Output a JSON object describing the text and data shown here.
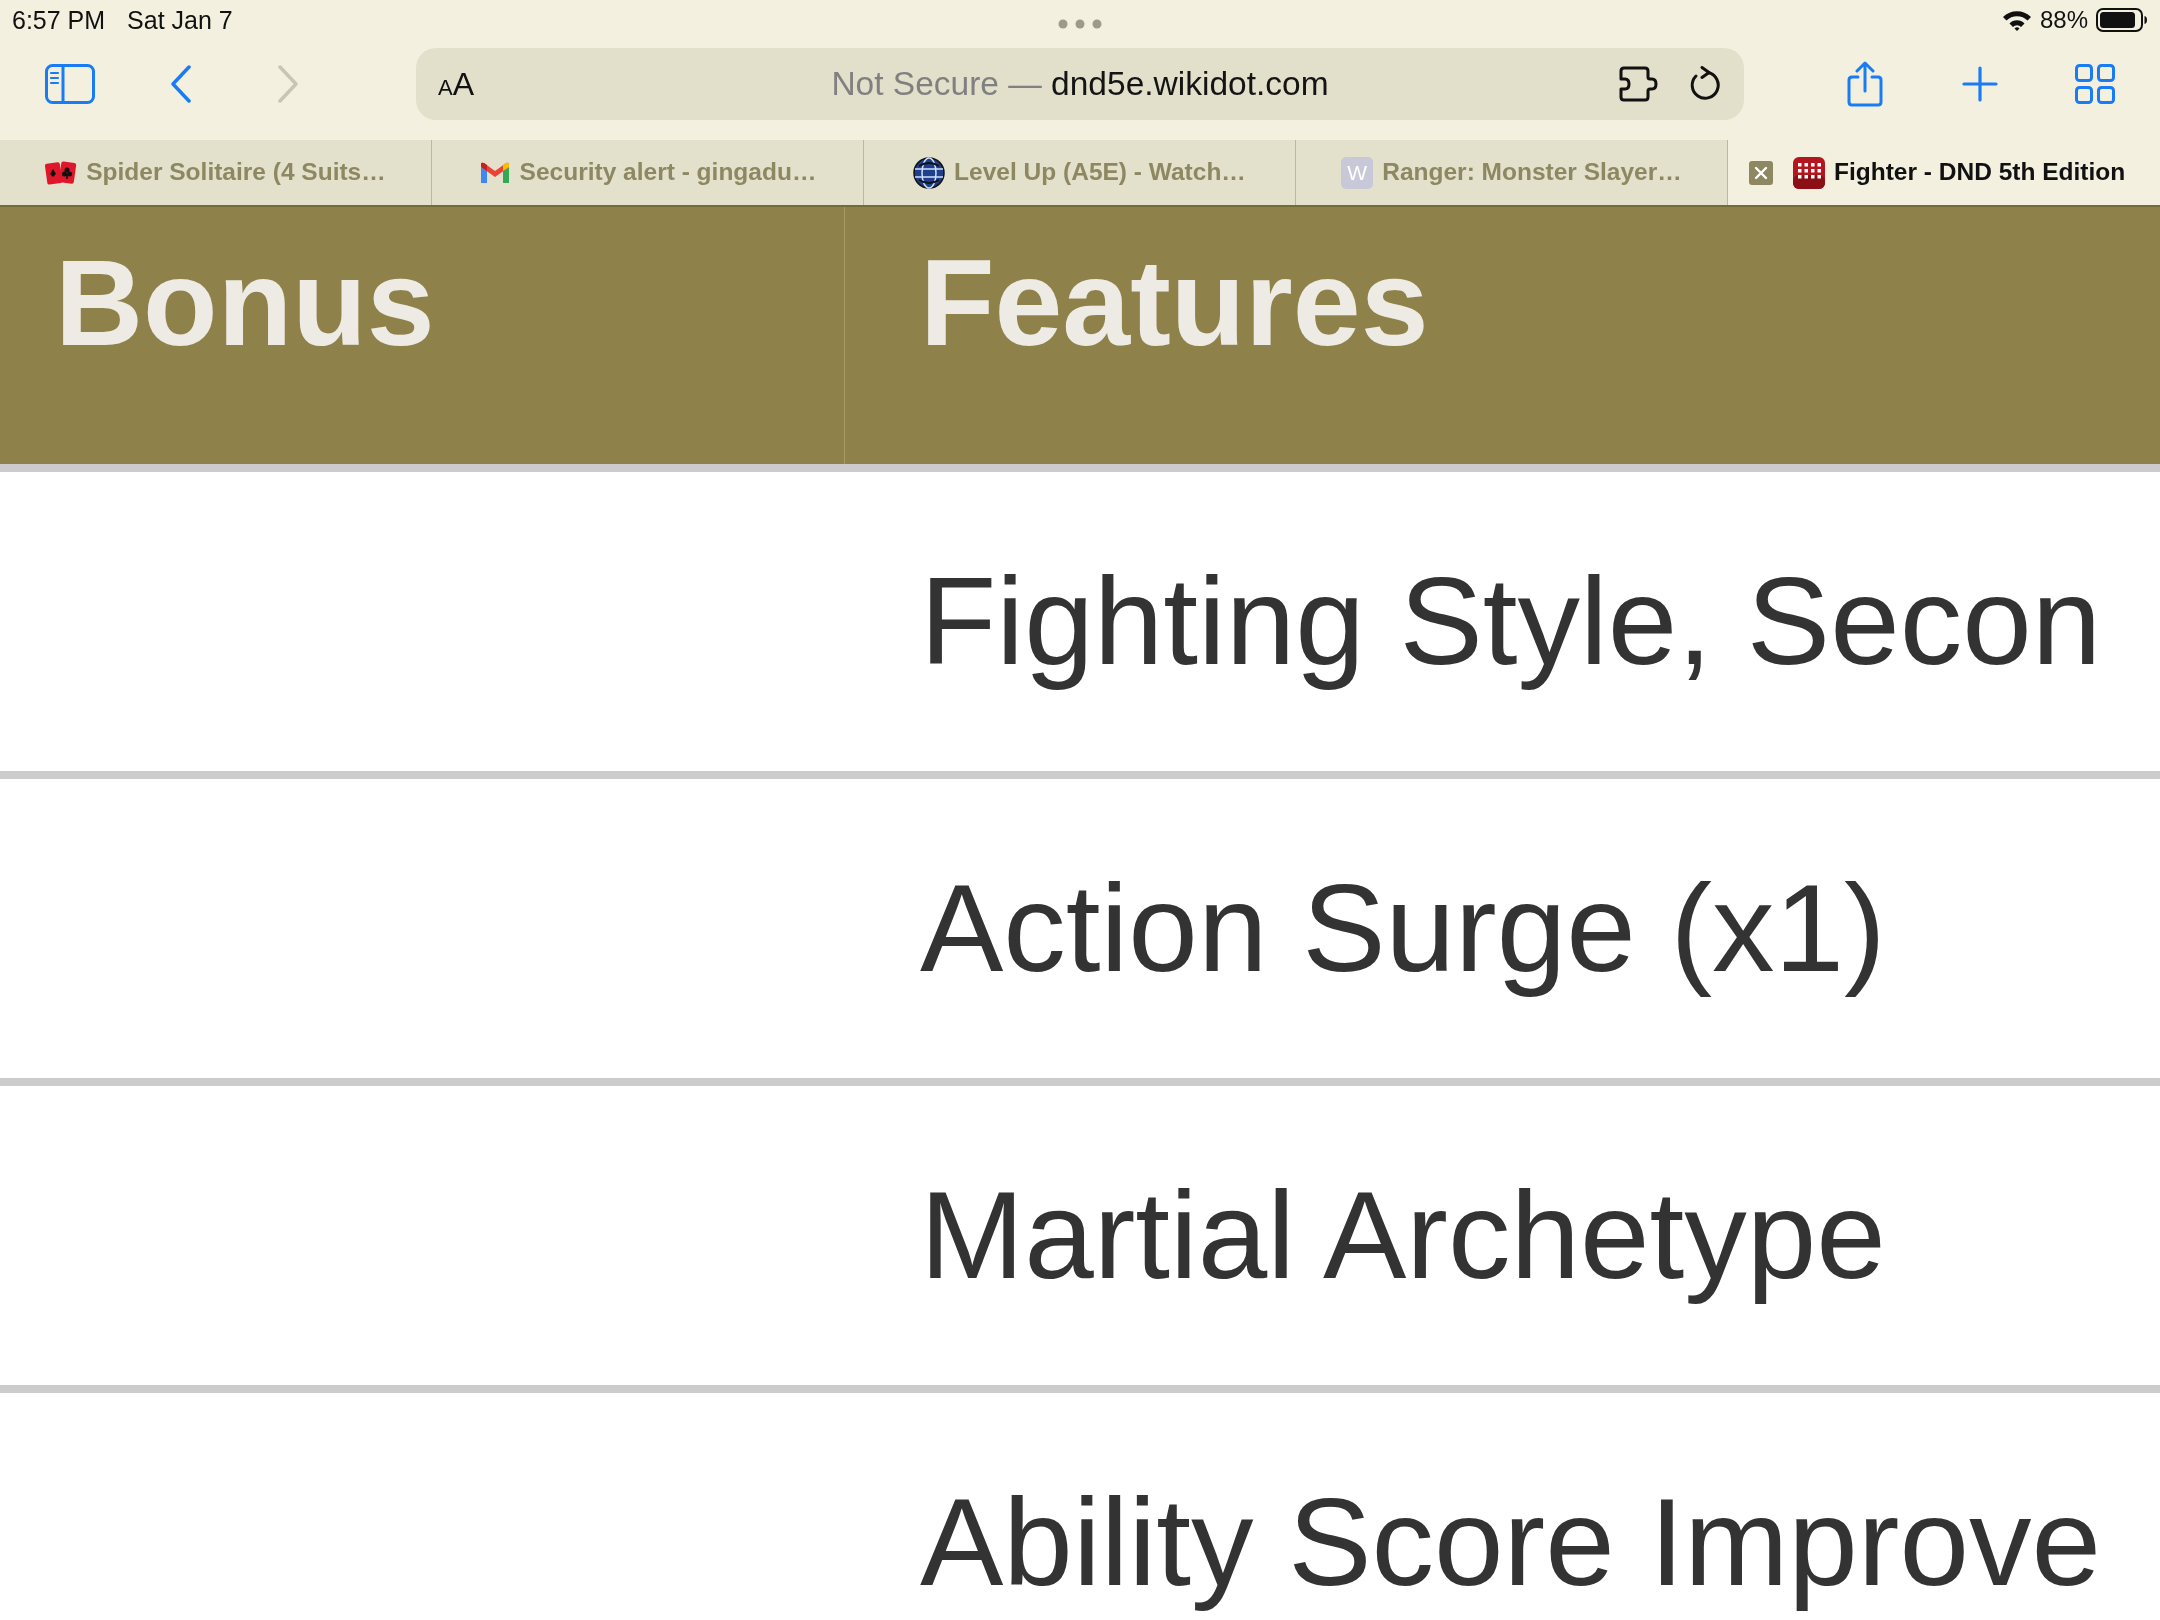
{
  "status_bar": {
    "time": "6:57 PM",
    "date": "Sat Jan 7",
    "battery_text": "88%"
  },
  "toolbar": {
    "back": {
      "disabled": false
    },
    "forward": {
      "disabled": true
    },
    "format_button": {
      "small": "A",
      "large": "A"
    },
    "address_bar": {
      "prefix": "Not Secure —",
      "domain": "dnd5e.wikidot.com"
    }
  },
  "tabs": [
    {
      "title": "Spider Solitaire (4 Suits…",
      "kind": "cards",
      "selected": false
    },
    {
      "title": "Security alert - gingadu…",
      "kind": "mail",
      "selected": false
    },
    {
      "title": "Level Up (A5E) - Watch…",
      "kind": "globe",
      "selected": false
    },
    {
      "title": "Ranger: Monster Slayer…",
      "kind": "letter",
      "favicon_text": "W",
      "selected": false
    },
    {
      "title": "Fighter - DND 5th Edition",
      "kind": "dice",
      "selected": true
    }
  ],
  "table": {
    "columns": [
      "Bonus",
      "Features"
    ],
    "rows": [
      {
        "features": "Fighting Style, Secon"
      },
      {
        "features": "Action Surge (x1)"
      },
      {
        "features": "Martial Archetype"
      },
      {
        "features": "Ability Score Improve"
      }
    ]
  }
}
